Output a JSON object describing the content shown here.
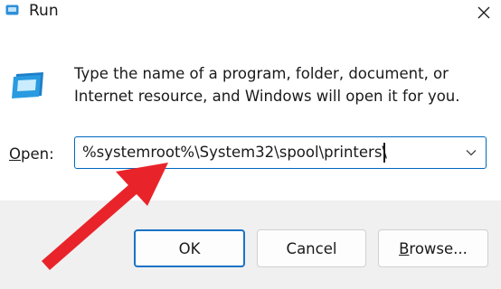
{
  "window": {
    "title": "Run",
    "icon": "run-app-icon",
    "close_icon": "close-icon"
  },
  "dialog": {
    "icon": "run-dialog-icon",
    "description": "Type the name of a program, folder, document, or Internet resource, and Windows will open it for you.",
    "open_label_key": "O",
    "open_label_rest": "pen:",
    "open_value": "%systemroot%\\System32\\spool\\printers\\",
    "dropdown_icon": "chevron-down-icon"
  },
  "buttons": {
    "ok": "OK",
    "cancel": "Cancel",
    "browse_key": "B",
    "browse_rest": "rowse..."
  },
  "annotation": {
    "arrow_color": "#e8242a",
    "arrow_icon": "red-arrow-icon"
  },
  "colors": {
    "accent": "#0067c0",
    "footer_bg": "#f0f0f0"
  }
}
